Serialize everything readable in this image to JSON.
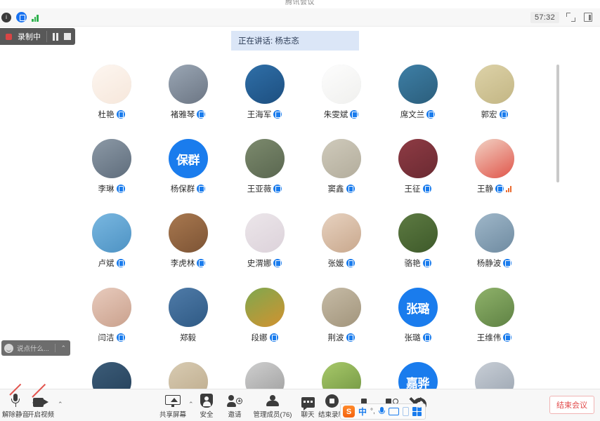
{
  "window": {
    "desktop_title": "腾讯会议",
    "titlebar": {
      "icons": [
        "shield-icon",
        "encryption-lock-icon",
        "network-signal-icon"
      ],
      "timer": "57:32",
      "fullscreen_icon": "expand-icon",
      "layout_icon": "layout-view-icon"
    }
  },
  "recording": {
    "label": "录制中",
    "pause_icon": "pause-icon",
    "stop_icon": "stop-icon"
  },
  "speaking_banner": {
    "text": "正在讲话: 杨志忞"
  },
  "chat_input": {
    "placeholder": "说点什么...",
    "emoji_icon": "emoji-icon",
    "expand_icon": "chevron-up-icon"
  },
  "participants": [
    {
      "name": "杜艳",
      "verified": true,
      "speaking": false,
      "avatar_type": "photo",
      "avatar_colors": [
        "#fdf6f0",
        "#f6e7db"
      ],
      "initial": ""
    },
    {
      "name": "褚雅琴",
      "verified": true,
      "speaking": false,
      "avatar_type": "photo",
      "avatar_colors": [
        "#9aa6b4",
        "#6c7684"
      ],
      "initial": ""
    },
    {
      "name": "王海军",
      "verified": true,
      "speaking": false,
      "avatar_type": "photo",
      "avatar_colors": [
        "#2f6fa8",
        "#1d4f80"
      ],
      "initial": ""
    },
    {
      "name": "朱雯斌",
      "verified": true,
      "speaking": false,
      "avatar_type": "photo",
      "avatar_colors": [
        "#fdfdfd",
        "#f0f0ee"
      ],
      "initial": ""
    },
    {
      "name": "席文兰",
      "verified": true,
      "speaking": false,
      "avatar_type": "photo",
      "avatar_colors": [
        "#3e7fa6",
        "#2b5e7c"
      ],
      "initial": ""
    },
    {
      "name": "郭宏",
      "verified": true,
      "speaking": false,
      "avatar_type": "photo",
      "avatar_colors": [
        "#ddd2a8",
        "#c3b684"
      ],
      "initial": ""
    },
    {
      "name": "李琳",
      "verified": true,
      "speaking": false,
      "avatar_type": "photo",
      "avatar_colors": [
        "#8c99a6",
        "#5f6d7c"
      ],
      "initial": ""
    },
    {
      "name": "杨保群",
      "verified": true,
      "speaking": false,
      "avatar_type": "text",
      "avatar_colors": [
        "#1a7ced",
        "#1a7ced"
      ],
      "initial": "保群"
    },
    {
      "name": "王亚薇",
      "verified": true,
      "speaking": false,
      "avatar_type": "photo",
      "avatar_colors": [
        "#7c8a6d",
        "#5a6750"
      ],
      "initial": ""
    },
    {
      "name": "窦鑫",
      "verified": true,
      "speaking": false,
      "avatar_type": "photo",
      "avatar_colors": [
        "#cfcabb",
        "#b3ad9c"
      ],
      "initial": ""
    },
    {
      "name": "王征",
      "verified": true,
      "speaking": false,
      "avatar_type": "photo",
      "avatar_colors": [
        "#8e3b44",
        "#6b2a32"
      ],
      "initial": ""
    },
    {
      "name": "王静",
      "verified": true,
      "speaking": true,
      "avatar_type": "photo",
      "avatar_colors": [
        "#f2d2c4",
        "#e0554a"
      ],
      "initial": ""
    },
    {
      "name": "卢斌",
      "verified": true,
      "speaking": false,
      "avatar_type": "photo",
      "avatar_colors": [
        "#79b7e0",
        "#4e93c4"
      ],
      "initial": ""
    },
    {
      "name": "李虎林",
      "verified": true,
      "speaking": false,
      "avatar_type": "photo",
      "avatar_colors": [
        "#a8784f",
        "#7d5435"
      ],
      "initial": ""
    },
    {
      "name": "史渭娜",
      "verified": true,
      "speaking": false,
      "avatar_type": "photo",
      "avatar_colors": [
        "#ece6ea",
        "#dcd2da"
      ],
      "initial": ""
    },
    {
      "name": "张媛",
      "verified": true,
      "speaking": false,
      "avatar_type": "photo",
      "avatar_colors": [
        "#e7d2c0",
        "#c9a88d"
      ],
      "initial": ""
    },
    {
      "name": "骆艳",
      "verified": true,
      "speaking": false,
      "avatar_type": "photo",
      "avatar_colors": [
        "#5d7a42",
        "#3e5a2a"
      ],
      "initial": ""
    },
    {
      "name": "杨静波",
      "verified": true,
      "speaking": false,
      "avatar_type": "photo",
      "avatar_colors": [
        "#9fb7c9",
        "#6f8ba1"
      ],
      "initial": ""
    },
    {
      "name": "闫洁",
      "verified": true,
      "speaking": false,
      "avatar_type": "photo",
      "avatar_colors": [
        "#e8cbbd",
        "#caa18d"
      ],
      "initial": ""
    },
    {
      "name": "郑毅",
      "verified": false,
      "speaking": false,
      "avatar_type": "photo",
      "avatar_colors": [
        "#4f7ba8",
        "#2f5a85"
      ],
      "initial": ""
    },
    {
      "name": "段娜",
      "verified": true,
      "speaking": false,
      "avatar_type": "photo",
      "avatar_colors": [
        "#7ea84f",
        "#d2922f"
      ],
      "initial": ""
    },
    {
      "name": "荆波",
      "verified": true,
      "speaking": false,
      "avatar_type": "photo",
      "avatar_colors": [
        "#c6bba6",
        "#a2957c"
      ],
      "initial": ""
    },
    {
      "name": "张璐",
      "verified": true,
      "speaking": false,
      "avatar_type": "text",
      "avatar_colors": [
        "#1a7ced",
        "#1a7ced"
      ],
      "initial": "张璐"
    },
    {
      "name": "王维伟",
      "verified": true,
      "speaking": false,
      "avatar_type": "photo",
      "avatar_colors": [
        "#8fb26a",
        "#5f8244"
      ],
      "initial": ""
    },
    {
      "name": "",
      "verified": false,
      "speaking": false,
      "avatar_type": "photo",
      "avatar_colors": [
        "#3c5c78",
        "#24405a"
      ],
      "initial": ""
    },
    {
      "name": "",
      "verified": false,
      "speaking": false,
      "avatar_type": "photo",
      "avatar_colors": [
        "#d8cbb2",
        "#bdab8c"
      ],
      "initial": ""
    },
    {
      "name": "",
      "verified": false,
      "speaking": false,
      "avatar_type": "photo",
      "avatar_colors": [
        "#cfcfcf",
        "#9d9d9d"
      ],
      "initial": ""
    },
    {
      "name": "",
      "verified": false,
      "speaking": false,
      "avatar_type": "photo",
      "avatar_colors": [
        "#a8c96a",
        "#6f9340"
      ],
      "initial": ""
    },
    {
      "name": "",
      "verified": false,
      "speaking": false,
      "avatar_type": "text",
      "avatar_colors": [
        "#1a7ced",
        "#1a7ced"
      ],
      "initial": "嘉骅"
    },
    {
      "name": "",
      "verified": false,
      "speaking": false,
      "avatar_type": "photo",
      "avatar_colors": [
        "#c8ced6",
        "#9aa4b0"
      ],
      "initial": ""
    }
  ],
  "toolbar": {
    "items": [
      {
        "label": "解除静音",
        "icon": "mic-muted-icon",
        "caret": true
      },
      {
        "label": "开启视频",
        "icon": "camera-off-icon",
        "caret": true
      },
      {
        "label": "共享屏幕",
        "icon": "share-screen-icon",
        "caret": true
      },
      {
        "label": "安全",
        "icon": "security-icon",
        "caret": false
      },
      {
        "label": "邀请",
        "icon": "invite-icon",
        "caret": false
      },
      {
        "label": "管理成员(76)",
        "icon": "manage-members-icon",
        "caret": false
      },
      {
        "label": "聊天",
        "icon": "chat-icon",
        "caret": false
      },
      {
        "label": "结束录制",
        "icon": "stop-recording-icon",
        "caret": false
      },
      {
        "label": "",
        "icon": "apps-icon",
        "caret": false
      },
      {
        "label": "",
        "icon": "more-apps-icon",
        "caret": false
      },
      {
        "label": "",
        "icon": "settings-gear-icon",
        "caret": false
      }
    ],
    "end_meeting": "结束会议"
  },
  "ime": {
    "logo": "S",
    "mode": "中",
    "punct": "°,",
    "voice_icon": "voice-input-icon",
    "keyboard_icon": "soft-keyboard-icon",
    "phone_icon": "phone-input-icon",
    "toolbox_icon": "ime-toolbox-icon"
  },
  "colors": {
    "accent": "#1a7ced",
    "danger": "#e24a4a",
    "banner_bg": "#dbe6f7",
    "toolbar_bg": "#f7f7f7"
  }
}
